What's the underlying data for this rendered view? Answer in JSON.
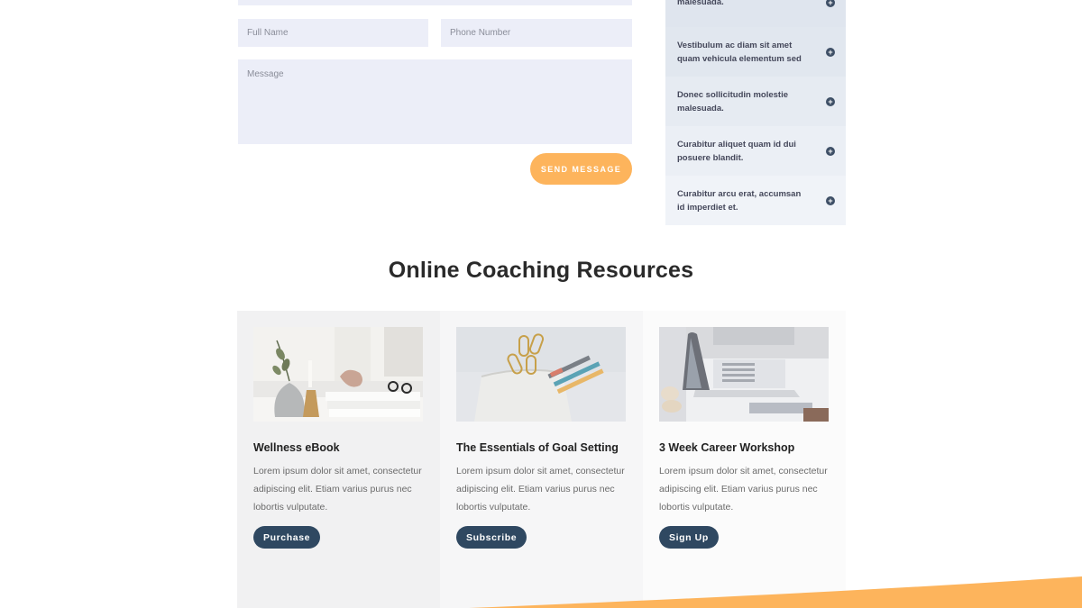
{
  "contact_form": {
    "full_name_placeholder": "Full Name",
    "phone_placeholder": "Phone Number",
    "message_placeholder": "Message",
    "send_label": "SEND MESSAGE"
  },
  "faq": {
    "items": [
      {
        "text": "malesuada."
      },
      {
        "text": "Vestibulum ac diam sit amet quam vehicula elementum sed"
      },
      {
        "text": "Donec sollicitudin molestie malesuada."
      },
      {
        "text": "Curabitur aliquet quam id dui posuere blandit."
      },
      {
        "text": "Curabitur arcu erat, accumsan id imperdiet et."
      }
    ]
  },
  "resources": {
    "title": "Online Coaching Resources",
    "cards": [
      {
        "title": "Wellness eBook",
        "description": "Lorem ipsum dolor sit amet, consectetur adipiscing elit. Etiam varius purus nec lobortis vulputate.",
        "button": "Purchase"
      },
      {
        "title": "The Essentials of Goal Setting",
        "description": "Lorem ipsum dolor sit amet, consectetur adipiscing elit. Etiam varius purus nec lobortis vulputate.",
        "button": "Subscribe"
      },
      {
        "title": "3 Week Career Workshop",
        "description": "Lorem ipsum dolor sit amet, consectetur adipiscing elit. Etiam varius purus nec lobortis vulputate.",
        "button": "Sign Up"
      }
    ]
  },
  "colors": {
    "accent_orange": "#fdb45c",
    "button_navy": "#2f4861",
    "field_bg": "#eceef8"
  }
}
